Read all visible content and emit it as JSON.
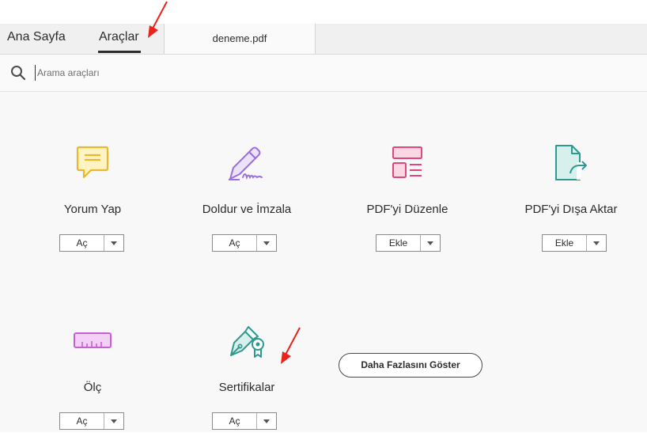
{
  "tabs": {
    "home": "Ana Sayfa",
    "tools": "Araçlar",
    "document": "deneme.pdf"
  },
  "search": {
    "placeholder": "Arama araçları",
    "value": ""
  },
  "tools": [
    {
      "name": "Yorum Yap",
      "action": "Aç",
      "icon": "comment-icon",
      "color": "#e8b82e"
    },
    {
      "name": "Doldur ve İmzala",
      "action": "Aç",
      "icon": "fill-sign-icon",
      "color": "#9b6fe0"
    },
    {
      "name": "PDF'yi Düzenle",
      "action": "Ekle",
      "icon": "edit-pdf-icon",
      "color": "#e0457b"
    },
    {
      "name": "PDF'yi Dışa Aktar",
      "action": "Ekle",
      "icon": "export-pdf-icon",
      "color": "#2d9a8f"
    },
    {
      "name": "Ölç",
      "action": "Aç",
      "icon": "ruler-icon",
      "color": "#c65fd0"
    },
    {
      "name": "Sertifikalar",
      "action": "Aç",
      "icon": "certificate-icon",
      "color": "#2d9a8f"
    }
  ],
  "more_button": "Daha Fazlasını Göster",
  "annotation_color": "#e8231d"
}
